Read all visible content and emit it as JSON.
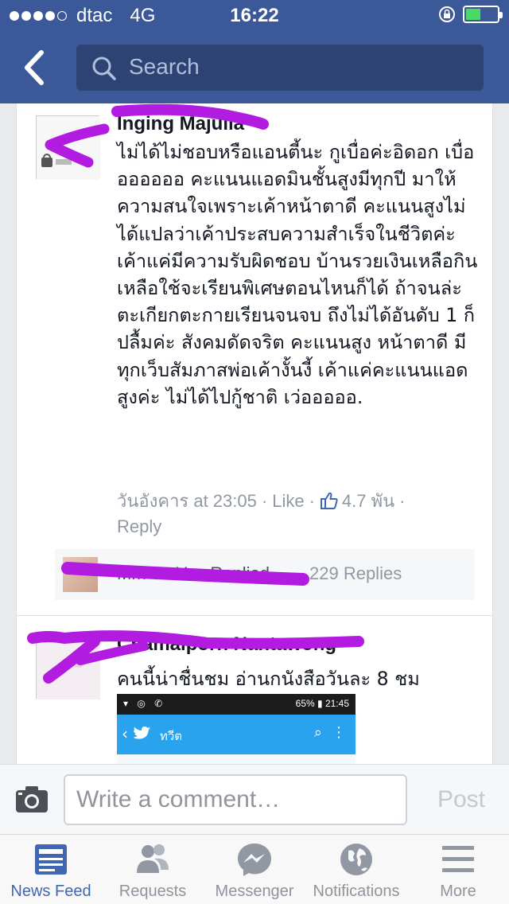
{
  "status_bar": {
    "carrier": "dtac",
    "network": "4G",
    "time": "16:22",
    "signal_bars_filled": 4,
    "signal_bars_total": 5
  },
  "nav": {
    "search_placeholder": "Search"
  },
  "comments": [
    {
      "author": "Inging Majulla",
      "text": "ไม่ได้ไม่ชอบหรือแอนตี้นะ กูเบื่อค่ะอิดอก เบื่อออออออ คะแนนแอดมินชั้นสูงมีทุกปี มาให้ความสนใจเพราะเค้าหน้าตาดี คะแนนสูงไม่ได้แปลว่าเค้าประสบความสำเร็จในชีวิตค่ะ เค้าแค่มีความรับผิดชอบ บ้านรวยเงินเหลือกินเหลือใช้จะเรียนพิเศษตอนไหนก็ได้ ถ้าจนล่ะตะเกียกตะกายเรียนจนจบ ถึงไม่ได้อันดับ 1 ก็ปลื้มค่ะ สังคมดัดจริต คะแนนสูง หน้าตาดี มีทุกเว็บสัมภาสพ่อเค้างั้นงี้ เค้าแค่คะแนนแอดสูงค่ะ ไม่ได้ไปกู้ชาติ เว่อออออ.",
      "timestamp": "วันอังคาร at 23:05",
      "like_label": "Like",
      "like_count": "4.7 พัน",
      "reply_label": "Reply",
      "replies": {
        "name": "Mm Ss You Replied",
        "count_label": "229 Replies"
      }
    },
    {
      "author": "Chamaiporn Nantawong",
      "text": "คนนี้น่าชื่นชม อ่านกนังสือวันละ 8 ชม",
      "embed": {
        "status_icons": "▾ ◎ ✆",
        "status_right": "65% ▮ 21:45",
        "app_title": "ทวีต",
        "search_icon": "search-icon",
        "more_icon": "more-icon"
      }
    }
  ],
  "composer": {
    "placeholder": "Write a comment…",
    "post_label": "Post"
  },
  "tabs": [
    {
      "label": "News Feed",
      "icon": "news-feed-icon",
      "active": true
    },
    {
      "label": "Requests",
      "icon": "requests-icon",
      "active": false
    },
    {
      "label": "Messenger",
      "icon": "messenger-icon",
      "active": false
    },
    {
      "label": "Notifications",
      "icon": "globe-icon",
      "active": false
    },
    {
      "label": "More",
      "icon": "menu-icon",
      "active": false
    }
  ],
  "colors": {
    "brand_blue": "#3b5998",
    "search_bg": "#2d4373",
    "scribble_purple": "#b21ce0",
    "active_tab": "#4267b2"
  }
}
